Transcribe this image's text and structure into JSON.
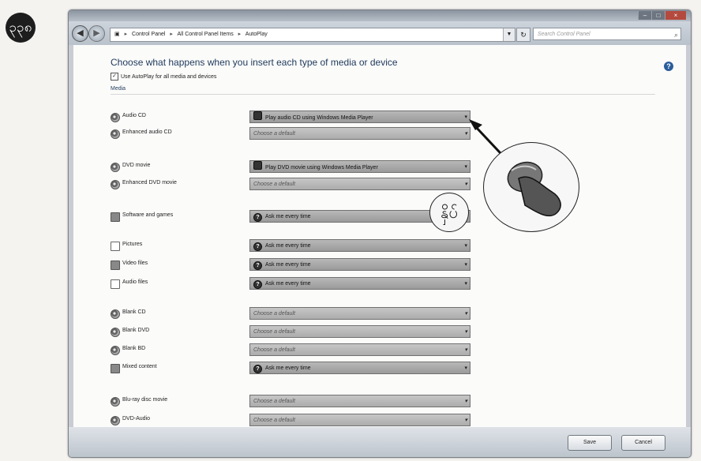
{
  "page_number": "၃၃၈",
  "window": {
    "breadcrumb": [
      "Control Panel",
      "All Control Panel Items",
      "AutoPlay"
    ],
    "search_placeholder": "Search Control Panel"
  },
  "content": {
    "title": "Choose what happens when you insert each type of media or device",
    "autoplay_checkbox_label": "Use AutoPlay for all media and devices",
    "section_label": "Media"
  },
  "media": [
    {
      "label": "Audio CD",
      "value": "Play audio CD using Windows Media Player",
      "icon": "disc-icon"
    },
    {
      "label": "Enhanced audio CD",
      "value": "Choose a default",
      "icon": "disc-icon"
    },
    {
      "label": "DVD movie",
      "value": "Play DVD movie using Windows Media Player",
      "icon": "disc-icon"
    },
    {
      "label": "Enhanced DVD movie",
      "value": "Choose a default",
      "icon": "disc-icon"
    },
    {
      "label": "Software and games",
      "value": "Ask me every time",
      "icon": "software-icon"
    },
    {
      "label": "Pictures",
      "value": "Ask me every time",
      "icon": "pictures-icon"
    },
    {
      "label": "Video files",
      "value": "Ask me every time",
      "icon": "video-icon"
    },
    {
      "label": "Audio files",
      "value": "Ask me every time",
      "icon": "audio-file-icon"
    },
    {
      "label": "Blank CD",
      "value": "Choose a default",
      "icon": "disc-icon"
    },
    {
      "label": "Blank DVD",
      "value": "Choose a default",
      "icon": "disc-icon"
    },
    {
      "label": "Blank BD",
      "value": "Choose a default",
      "icon": "disc-icon"
    },
    {
      "label": "Mixed content",
      "value": "Ask me every time",
      "icon": "mixed-content-icon"
    },
    {
      "label": "Blu-ray disc movie",
      "value": "Choose a default",
      "icon": "disc-icon"
    },
    {
      "label": "DVD-Audio",
      "value": "Choose a default",
      "icon": "disc-icon"
    }
  ],
  "annotation": {
    "callout_label": "နှိပ်"
  },
  "footer": {
    "save_label": "Save",
    "cancel_label": "Cancel"
  }
}
